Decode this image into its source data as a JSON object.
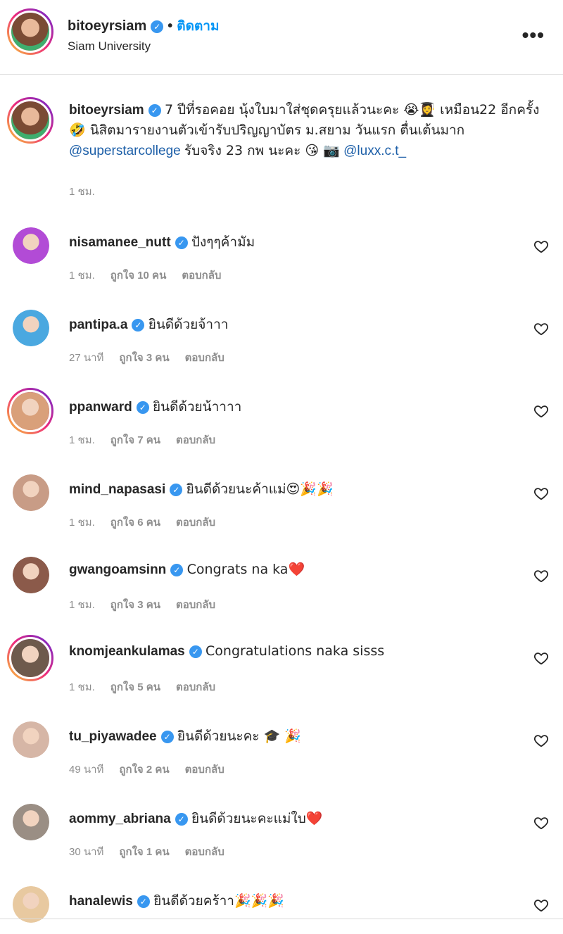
{
  "header": {
    "username": "bitoeyrsiam",
    "follow_label": "ติดตาม",
    "location": "Siam University",
    "more": "•••"
  },
  "caption": {
    "username": "bitoeyrsiam",
    "text_1": "7 ปีที่รอคอย นุ้งใบมาใส่ชุดครุยแล้วนะคะ 😭👩‍🎓 เหมือน22 อีกครั้ง🤣 นิสิตมารายงานตัวเข้ารับปริญญาบัตร ม.สยาม วันแรก ตื่นเต้นมาก",
    "mention_1": "@superstarcollege",
    "text_2": "รับจริง 23 กพ นะคะ 😘 📷",
    "mention_2": "@luxx.c.t_",
    "time": "1 ชม."
  },
  "comments": [
    {
      "username": "nisamanee_nutt",
      "text": "ปังๆๆค้ามัม",
      "time": "1 ชม.",
      "likes": "ถูกใจ 10 คน",
      "reply": "ตอบกลับ",
      "avatar_color": "#b24bd6",
      "ring": false
    },
    {
      "username": "pantipa.a",
      "text": "ยินดีด้วยจ้าาา",
      "time": "27 นาที",
      "likes": "ถูกใจ 3 คน",
      "reply": "ตอบกลับ",
      "avatar_color": "#4aa8e0",
      "ring": false
    },
    {
      "username": "ppanward",
      "text": "ยินดีด้วยน้าาาา",
      "time": "1 ชม.",
      "likes": "ถูกใจ 7 คน",
      "reply": "ตอบกลับ",
      "avatar_color": "#d9a07a",
      "ring": true
    },
    {
      "username": "mind_napasasi",
      "text": "ยินดีด้วยนะค้าแม่😍🎉🎉",
      "time": "1 ชม.",
      "likes": "ถูกใจ 6 คน",
      "reply": "ตอบกลับ",
      "avatar_color": "#c89c86",
      "ring": false
    },
    {
      "username": "gwangoamsinn",
      "text": "Congrats na ka❤️",
      "time": "1 ชม.",
      "likes": "ถูกใจ 3 คน",
      "reply": "ตอบกลับ",
      "avatar_color": "#8b5a4a",
      "ring": false
    },
    {
      "username": "knomjeankulamas",
      "text": "Congratulations naka sisss",
      "time": "1 ชม.",
      "likes": "ถูกใจ 5 คน",
      "reply": "ตอบกลับ",
      "avatar_color": "#6e5a4c",
      "ring": true
    },
    {
      "username": "tu_piyawadee",
      "text": "ยินดีด้วยนะคะ 🎓 🎉",
      "time": "49 นาที",
      "likes": "ถูกใจ 2 คน",
      "reply": "ตอบกลับ",
      "avatar_color": "#d6b6a6",
      "ring": false
    },
    {
      "username": "aommy_abriana",
      "text": "ยินดีด้วยนะคะแม่ใบ❤️",
      "time": "30 นาที",
      "likes": "ถูกใจ 1 คน",
      "reply": "ตอบกลับ",
      "avatar_color": "#9a8e84",
      "ring": false
    },
    {
      "username": "hanalewis",
      "text": "ยินดีด้วยคร้าา🎉🎉🎉",
      "time": "",
      "likes": "",
      "reply": "",
      "avatar_color": "#e8c9a0",
      "ring": false
    }
  ],
  "colors": {
    "link": "#0095f6",
    "verified": "#3897f0",
    "muted": "#8e8e8e",
    "main_avatar": "#c98a6e"
  }
}
